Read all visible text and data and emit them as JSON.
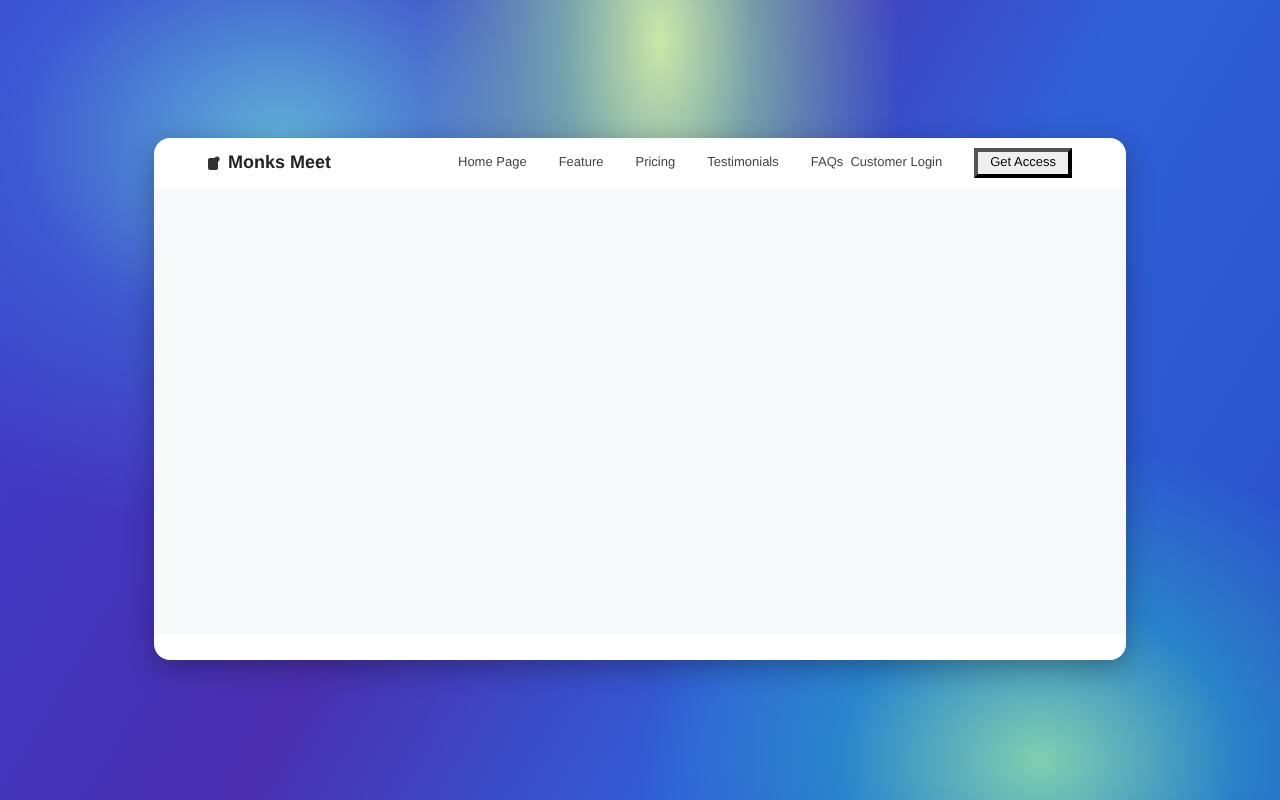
{
  "brand": {
    "name": "Monks Meet"
  },
  "nav": {
    "links": [
      {
        "label": "Home Page"
      },
      {
        "label": "Feature"
      },
      {
        "label": "Pricing"
      },
      {
        "label": "Testimonials"
      },
      {
        "label": "FAQs"
      }
    ]
  },
  "actions": {
    "login": "Customer Login",
    "cta": "Get Access"
  }
}
